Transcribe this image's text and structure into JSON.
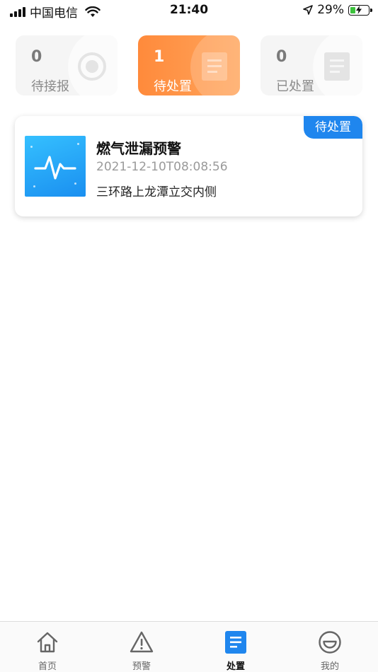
{
  "status_bar": {
    "carrier": "中国电信",
    "time": "21:40",
    "battery": "29%",
    "battery_level": 0.29
  },
  "stats": [
    {
      "count": "0",
      "label": "待接报",
      "active": false,
      "icon": "record-icon"
    },
    {
      "count": "1",
      "label": "待处置",
      "active": true,
      "icon": "document-icon"
    },
    {
      "count": "0",
      "label": "已处置",
      "active": false,
      "icon": "document-icon"
    }
  ],
  "card": {
    "badge": "待处置",
    "title": "燃气泄漏预警",
    "time": "2021-12-10T08:08:56",
    "address": "三环路上龙潭立交内侧",
    "thumb_icon": "pulse-icon"
  },
  "tabbar": {
    "items": [
      {
        "label": "首页",
        "icon": "home-icon",
        "active": false
      },
      {
        "label": "预警",
        "icon": "warning-icon",
        "active": false
      },
      {
        "label": "处置",
        "icon": "list-doc-icon",
        "active": true
      },
      {
        "label": "我的",
        "icon": "smile-icon",
        "active": false
      }
    ]
  },
  "colors": {
    "accent_orange": "#ff8a3b",
    "accent_blue": "#1f86ee",
    "battery_green": "#3cc23c"
  }
}
